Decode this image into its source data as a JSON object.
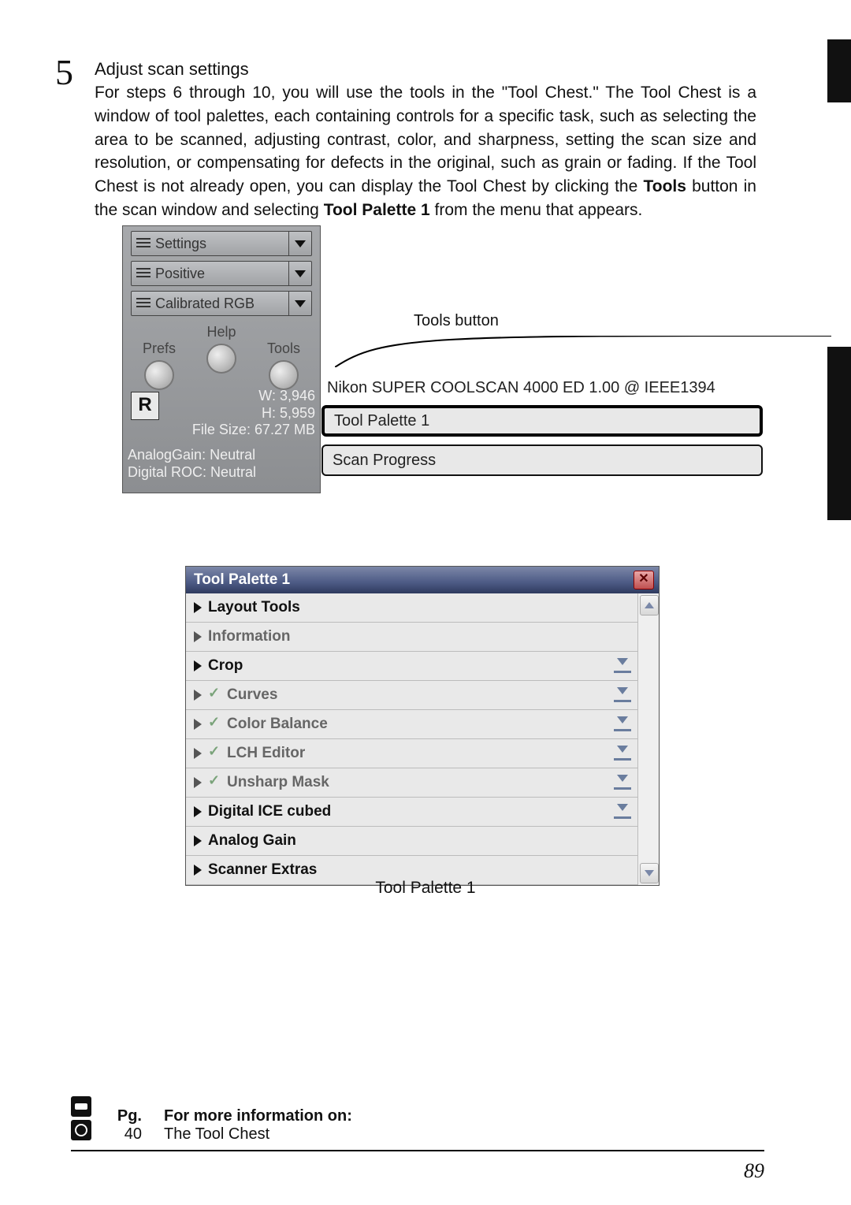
{
  "step": {
    "number": "5",
    "title": "Adjust scan settings",
    "body_plain": "For steps 6 through 10, you will use the tools in the \"Tool Chest.\"  The Tool Chest is a window of tool palettes, each containing controls for a specific task, such as selecting the area to be scanned, adjusting contrast, color, and sharpness, setting the scan size and resolution, or compensating for defects in the original, such as grain or fading.  If the Tool Chest is not already open, you can display the Tool Chest by clicking the ",
    "bold1": "Tools",
    "body_mid": " button in the scan window and selecting ",
    "bold2": "Tool Palette 1",
    "body_tail": " from the menu that appears."
  },
  "scan_panel": {
    "dropdowns": {
      "settings": "Settings",
      "positive": "Positive",
      "colorspace": "Calibrated RGB"
    },
    "labels": {
      "help": "Help",
      "prefs": "Prefs",
      "tools": "Tools"
    },
    "r_badge": "R",
    "info": {
      "w": "W: 3,946",
      "h": "H: 5,959",
      "size": "File Size: 67.27 MB",
      "again": "AnalogGain: Neutral",
      "droc": "Digital ROC: Neutral"
    }
  },
  "callout": {
    "tools_button": "Tools button"
  },
  "scanner": {
    "title": "Nikon  SUPER  COOLSCAN  4000 ED 1.00 @ IEEE1394",
    "menu_hl": "Tool Palette 1",
    "menu_sp": "Scan Progress"
  },
  "palette": {
    "title": "Tool Palette 1",
    "rows": [
      {
        "label": "Layout Tools",
        "active": true,
        "check": false,
        "dd": false
      },
      {
        "label": "Information",
        "active": false,
        "check": false,
        "dd": false
      },
      {
        "label": "Crop",
        "active": true,
        "check": false,
        "dd": true
      },
      {
        "label": "Curves",
        "active": false,
        "check": true,
        "dd": true
      },
      {
        "label": "Color Balance",
        "active": false,
        "check": true,
        "dd": true
      },
      {
        "label": "LCH Editor",
        "active": false,
        "check": true,
        "dd": true
      },
      {
        "label": "Unsharp Mask",
        "active": false,
        "check": true,
        "dd": true
      },
      {
        "label": "Digital ICE cubed",
        "active": true,
        "check": false,
        "dd": true
      },
      {
        "label": "Analog Gain",
        "active": true,
        "check": false,
        "dd": false
      },
      {
        "label": "Scanner Extras",
        "active": true,
        "check": false,
        "dd": false
      }
    ],
    "caption": "Tool Palette 1"
  },
  "footer": {
    "head_pg": "Pg.",
    "head_topic": "For more information on:",
    "rows": [
      {
        "pg": "40",
        "topic": "The Tool Chest"
      }
    ]
  },
  "page_number": "89"
}
